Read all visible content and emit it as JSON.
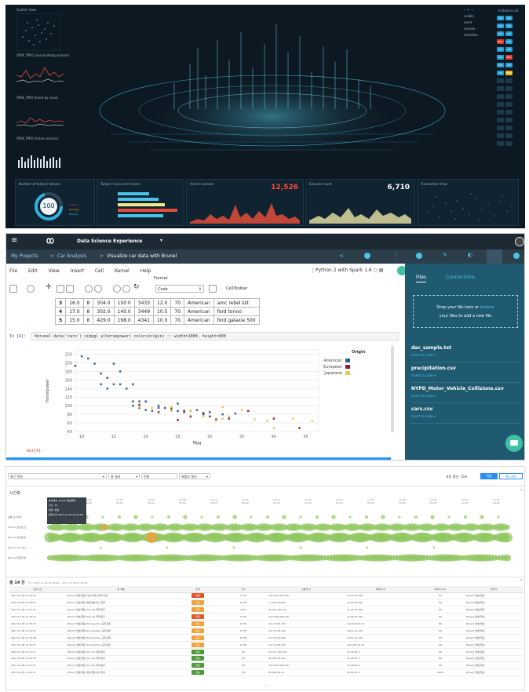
{
  "dashboard": {
    "scatter_title": "Scatter View",
    "chart_titles": [
      "[PEN_TM0] Load building analysis",
      "[PEN_TM0] Event by count",
      "[PEN_TM0] Active sessions"
    ],
    "legend_items": [
      "visible",
      "reset",
      "rescale",
      "trendline"
    ],
    "status_title": "Instance List",
    "status_tiles": [
      {
        "label": "OK",
        "color": "#1f9fd6"
      },
      {
        "label": "OK",
        "color": "#1f9fd6"
      },
      {
        "label": "OK",
        "color": "#1f9fd6"
      },
      {
        "label": "OK",
        "color": "#1f9fd6"
      },
      {
        "label": "OK",
        "color": "#1f9fd6"
      },
      {
        "label": "OK",
        "color": "#1f9fd6"
      },
      {
        "label": "ERR",
        "color": "#e0392b"
      },
      {
        "label": "OK",
        "color": "#1f9fd6"
      },
      {
        "label": "OK",
        "color": "#1f9fd6"
      },
      {
        "label": "OK",
        "color": "#1f9fd6"
      },
      {
        "label": "OK",
        "color": "#1f9fd6"
      },
      {
        "label": "ERR",
        "color": "#e0392b"
      },
      {
        "label": "OK",
        "color": "#1f9fd6"
      },
      {
        "label": "OK",
        "color": "#1f9fd6"
      },
      {
        "label": "OK",
        "color": "#1f9fd6"
      },
      {
        "label": "WRN",
        "color": "#e8b21a"
      }
    ],
    "bottom": {
      "failure_title": "Number of today's failures",
      "failure_value": "100",
      "failure_legend": [
        "Critical",
        "Warning",
        "Normal"
      ],
      "concurrent_title": "Today's Concurrent Users",
      "active_title": "Active sessions",
      "active_value": "12,526",
      "execute_title": "Execute count",
      "execute_value": "6,710",
      "transaction_title": "Transaction View"
    }
  },
  "notebook": {
    "brand": "Data Science Experience",
    "breadcrumb": [
      "My Projects",
      ">",
      "Car Analysis",
      ">",
      "Visualize car data with Brunel"
    ],
    "menu": [
      "File",
      "Edit",
      "View",
      "Insert",
      "Cell",
      "Kernel",
      "Help"
    ],
    "kernel": "Python 2 with Spark 1.6",
    "format_label": "Format",
    "cell_type": "Code",
    "celltoolbar": "CellToolbar",
    "table_rows": [
      [
        "3",
        "16.0",
        "8",
        "304.0",
        "150.0",
        "3433",
        "12.0",
        "70",
        "American",
        "amc rebel sst"
      ],
      [
        "4",
        "17.0",
        "8",
        "302.0",
        "140.0",
        "3449",
        "10.5",
        "70",
        "American",
        "ford torino"
      ],
      [
        "5",
        "15.0",
        "8",
        "429.0",
        "198.0",
        "4341",
        "10.0",
        "70",
        "American",
        "ford galaxie 500"
      ]
    ],
    "cell_prompt": "In [4]:",
    "cell_code": "%brunel data('cars') x(mpg) y(horsepower) color(origin) :: width=1000, height=600",
    "out_prompt": "Out[4]:",
    "files_tab": "Files",
    "connections_tab": "Connections",
    "drop_text": "Drop your file here or",
    "browse": "browse",
    "drop_text2": "your files to add a new file",
    "files": [
      {
        "name": "dac_sample.txt",
        "action": "Insert to code"
      },
      {
        "name": "precipitation.csv",
        "action": "Insert to code"
      },
      {
        "name": "NYPD_Motor_Vehicle_Collisions.csv",
        "action": "Insert to code"
      },
      {
        "name": "cars.csv",
        "action": "Insert to code"
      }
    ]
  },
  "chart_data": {
    "type": "scatter",
    "xlabel": "Mpg",
    "ylabel": "Horsepower",
    "xlim": [
      9,
      47
    ],
    "ylim": [
      40,
      230
    ],
    "xticks": [
      "10",
      "15",
      "20",
      "25",
      "30",
      "35",
      "40",
      "45"
    ],
    "yticks": [
      "40",
      "60",
      "80",
      "100",
      "120",
      "140",
      "160",
      "180",
      "200",
      "220"
    ],
    "legend_title": "Origin",
    "series": [
      {
        "name": "American",
        "color": "#2b5f8c",
        "points": [
          [
            9,
            193
          ],
          [
            10,
            215
          ],
          [
            11,
            210
          ],
          [
            12,
            198
          ],
          [
            13,
            175
          ],
          [
            13,
            150
          ],
          [
            14,
            165
          ],
          [
            14,
            140
          ],
          [
            15,
            150
          ],
          [
            15,
            198
          ],
          [
            16,
            150
          ],
          [
            16,
            180
          ],
          [
            17,
            140
          ],
          [
            18,
            150
          ],
          [
            18,
            110
          ],
          [
            18,
            100
          ],
          [
            19,
            110
          ],
          [
            19,
            95
          ],
          [
            20,
            110
          ],
          [
            20,
            90
          ],
          [
            21,
            88
          ],
          [
            22,
            100
          ],
          [
            22,
            95
          ],
          [
            23,
            95
          ],
          [
            24,
            90
          ],
          [
            25,
            88
          ],
          [
            25,
            105
          ],
          [
            26,
            85
          ],
          [
            27,
            88
          ],
          [
            28,
            90
          ],
          [
            29,
            80
          ],
          [
            30,
            85
          ],
          [
            32,
            80
          ],
          [
            34,
            82
          ]
        ]
      },
      {
        "name": "European",
        "color": "#8c1f2f",
        "points": [
          [
            19,
            102
          ],
          [
            22,
            85
          ],
          [
            24,
            95
          ],
          [
            25,
            67
          ],
          [
            26,
            88
          ],
          [
            27,
            75
          ],
          [
            29,
            83
          ],
          [
            30,
            75
          ],
          [
            31,
            68
          ],
          [
            33,
            70
          ],
          [
            36,
            88
          ],
          [
            40,
            70
          ],
          [
            44,
            48
          ]
        ]
      },
      {
        "name": "Japanese",
        "color": "#e6c84c",
        "points": [
          [
            19,
            97
          ],
          [
            21,
            95
          ],
          [
            24,
            88
          ],
          [
            24,
            97
          ],
          [
            27,
            88
          ],
          [
            29,
            75
          ],
          [
            31,
            65
          ],
          [
            32,
            70
          ],
          [
            32,
            97
          ],
          [
            33,
            75
          ],
          [
            35,
            90
          ],
          [
            37,
            68
          ],
          [
            39,
            65
          ],
          [
            40,
            48
          ],
          [
            43,
            70
          ],
          [
            46,
            65
          ]
        ]
      }
    ]
  },
  "timeline": {
    "filter1": "최근 한달",
    "filter2": "총 걸러",
    "filter3": "전체",
    "filter4": "위험도 필터",
    "right_label": "자동 갱신: 15초",
    "btn_primary": "적용",
    "btn_secondary": "엑스포트",
    "section_title": "시간축",
    "time_labels": [
      "11-45\n00:00",
      "11-50\n00:00",
      "11-55\n00:00",
      "12-00\n00:00",
      "12-05\n00:00",
      "12-10\n00:00",
      "12-15\n00:00",
      "12-20\n00:00",
      "12-25\n00:00",
      "12-30\n00:00",
      "12-35\n00:00",
      "12-40\n00:00",
      "12-45\n00:00",
      "12-50\n00:00",
      "12-55\n00:00"
    ],
    "row_labels": [
      "공통 모니터링",
      "[Event_명호사건]",
      "[Event_명호위험]",
      "[Event_risk-LR]",
      "[Event_위험지역]"
    ],
    "tooltip": [
      "분석대상",
      "Event_명호위험",
      "건수",
      "15",
      "분류",
      "위험",
      "탐지시간",
      "2017-11-28 11:05:00"
    ],
    "summary": "총 14 건",
    "summary_detail": "기간 : 2017-11-28 11:00:00 ~ 2017-11-28 11:59:59",
    "headers": [
      "탐지시간",
      "룰 이름",
      "상태",
      "건수",
      "출발지 IP",
      "목적지 IP",
      "목적지 Port",
      "관리자"
    ],
    "rows": [
      [
        "2017-11-28 11:48:47",
        "[Event_명호위험] 다중 유해 트래픽 감지",
        "위험",
        "37.55",
        "222.182.188.130",
        "10.28.22.200",
        "80",
        "[Event_명호위험]"
      ],
      [
        "2017-11-28 11:38:57",
        "[Event_명호위험] 명호위험 경고 탐지",
        "경고",
        "37.55",
        "17.181.226.82",
        "10.28.22.200",
        "80",
        "[Event_명호위험]"
      ],
      [
        "2017-11-28 11:37:35",
        "[Event_명호위험] Tim Up 최대 탐지",
        "경고",
        "80.0",
        "82.224.165.79",
        "10.28.22.200",
        "80",
        "[Event_명호위험]"
      ],
      [
        "2017-11-28 11:36:27",
        "[Event_명호위험] Tim Up 최대 탐지",
        "위험",
        "37.55",
        "222.182.188.130",
        "10.28.22.200",
        "80",
        "[Event_명호위험]"
      ],
      [
        "2017-11-28 11:35:37",
        "[Event_명호위험] 0Q injection 공격 탐지",
        "경고",
        "27.55",
        "111.70.26.153",
        "142.132.22.11",
        "80",
        "[Event_명호위험]"
      ],
      [
        "2017-11-28 11:34:57",
        "[Event_명호위험] 0Q injection 공격 탐지",
        "경고",
        "27.55",
        "111.70.26.263",
        "142.1.41.100",
        "80",
        "[Event_명호위험]"
      ],
      [
        "2017-11-28 11:33:48",
        "[Event_명호위험] 0Q injection 공격 탐지",
        "경고",
        "27.55",
        "113.70.26.263",
        "142.1.41.100",
        "80",
        "[Event_명호위험]"
      ],
      [
        "2017-11-28 11:32:07",
        "[Event_명호위험] 0Q injection 공격 탐지",
        "경고",
        "27.55",
        "111.70.26.263",
        "142.132.22.13",
        "80",
        "[Event_명호위험]"
      ],
      [
        "2017-11-28 11:31:12",
        "[Event_명호위험] Tim Up 최대 탐지",
        "정상",
        "8.5",
        "110.17.102.237",
        "10.28.26.7",
        "80",
        "[Event_명호위험]"
      ],
      [
        "2017-11-28 11:28:18",
        "[Event_명호위험] Tim Up 최대 탐지",
        "정상",
        "8.5",
        "82.256.18.141",
        "10.28.22.1",
        "80",
        "[Event_명호위험]"
      ],
      [
        "2017-11-28 11:27:51",
        "[Event_명호위험] Tim Up 최대 탐지",
        "정상",
        "8.5",
        "222.182.188.130",
        "10.28.26.7",
        "80",
        "[Event_명호위험]"
      ],
      [
        "2017-11-28 11:26:37",
        "[Event_명호위험] 명호위험 공격 탐지",
        "정상",
        "8.5",
        "61.169.28.11",
        "10.28.22.1",
        "4028",
        "[Event_명호위험]"
      ]
    ],
    "status_colors": {
      "위험": "#e0572b",
      "경고": "#f0a03a",
      "정상": "#4e9a3c"
    }
  }
}
